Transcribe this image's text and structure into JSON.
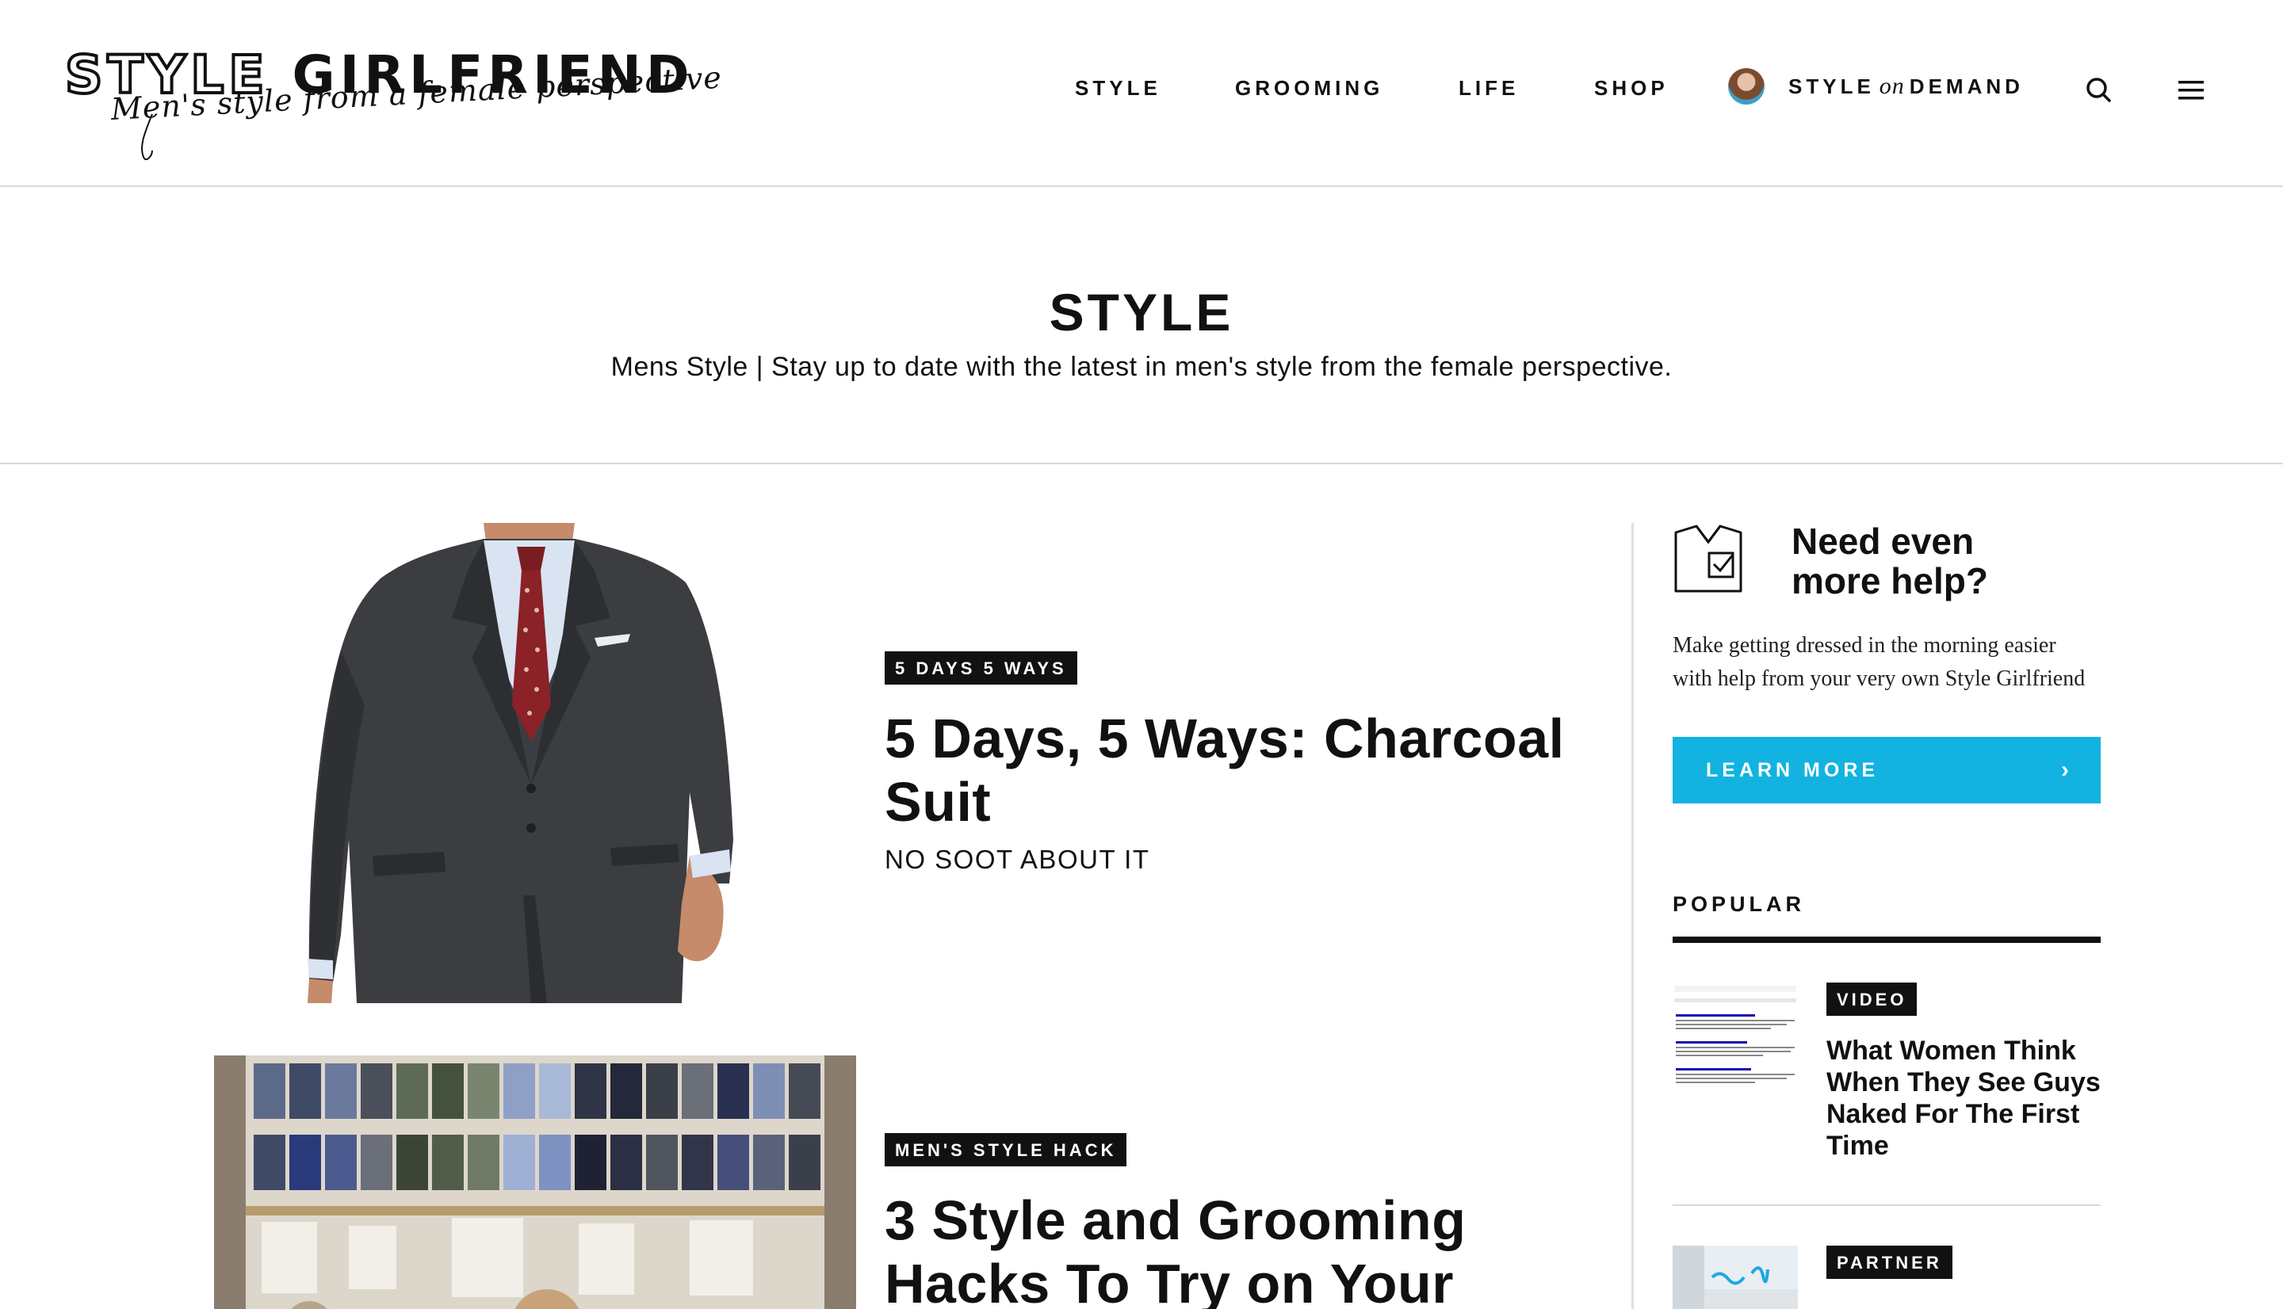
{
  "header": {
    "logo_main_outline": "STYLE",
    "logo_main_solid": "GIRLFRIEND",
    "logo_tagline": "Men's style from a female perspective",
    "nav": [
      {
        "label": "STYLE"
      },
      {
        "label": "GROOMING"
      },
      {
        "label": "LIFE"
      },
      {
        "label": "SHOP"
      }
    ],
    "style_on_demand": {
      "pre": "STYLE",
      "mid": "on",
      "post": "DEMAND"
    },
    "search_icon": "search-icon",
    "menu_icon": "hamburger-menu-icon"
  },
  "category": {
    "title": "STYLE",
    "description": "Mens Style | Stay up to date with the latest in men's style from the female perspective."
  },
  "articles": [
    {
      "tag": "5 DAYS 5 WAYS",
      "title": "5 Days, 5 Ways: Charcoal Suit",
      "subtitle": "NO SOOT ABOUT IT"
    },
    {
      "tag": "MEN'S STYLE HACK",
      "title": "3 Style and Grooming Hacks To Try on Your"
    }
  ],
  "sidebar": {
    "help": {
      "title": "Need even more help?",
      "text": "Make getting dressed in the morning easier with help from your very own Style Girlfriend",
      "button_label": "LEARN MORE"
    },
    "popular": {
      "heading": "POPULAR",
      "items": [
        {
          "tag": "VIDEO",
          "title": "What Women Think When They See Guys Naked For The First Time"
        },
        {
          "tag": "PARTNER",
          "title": ""
        }
      ]
    }
  },
  "colors": {
    "accent": "#12b3e0",
    "text": "#111111",
    "divider": "#d9d9d9"
  }
}
